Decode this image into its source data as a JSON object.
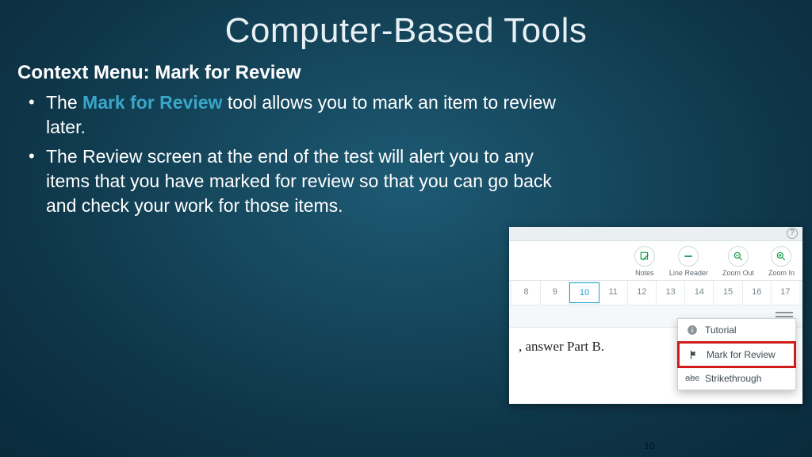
{
  "title": "Computer-Based Tools",
  "subheading": "Context Menu: Mark for Review",
  "bullets": {
    "b1_pre": "The ",
    "b1_hl": "Mark for Review",
    "b1_post": " tool allows you to mark an item to review later.",
    "b2": "The Review screen at the end of the test will alert you to any items that you have marked for review so that you can go back and check your work for those items."
  },
  "toolbar": {
    "notes": "Notes",
    "line_reader": "Line Reader",
    "zoom_out": "Zoom Out",
    "zoom_in": "Zoom In"
  },
  "questions": [
    "8",
    "9",
    "10",
    "11",
    "12",
    "13",
    "14",
    "15",
    "16",
    "17"
  ],
  "selected_q": "10",
  "question_fragment": ", answer Part B.",
  "menu": {
    "tutorial": "Tutorial",
    "mark": "Mark for Review",
    "strike": "Strikethrough",
    "strike_icon": "abc"
  },
  "slide_number": "10"
}
